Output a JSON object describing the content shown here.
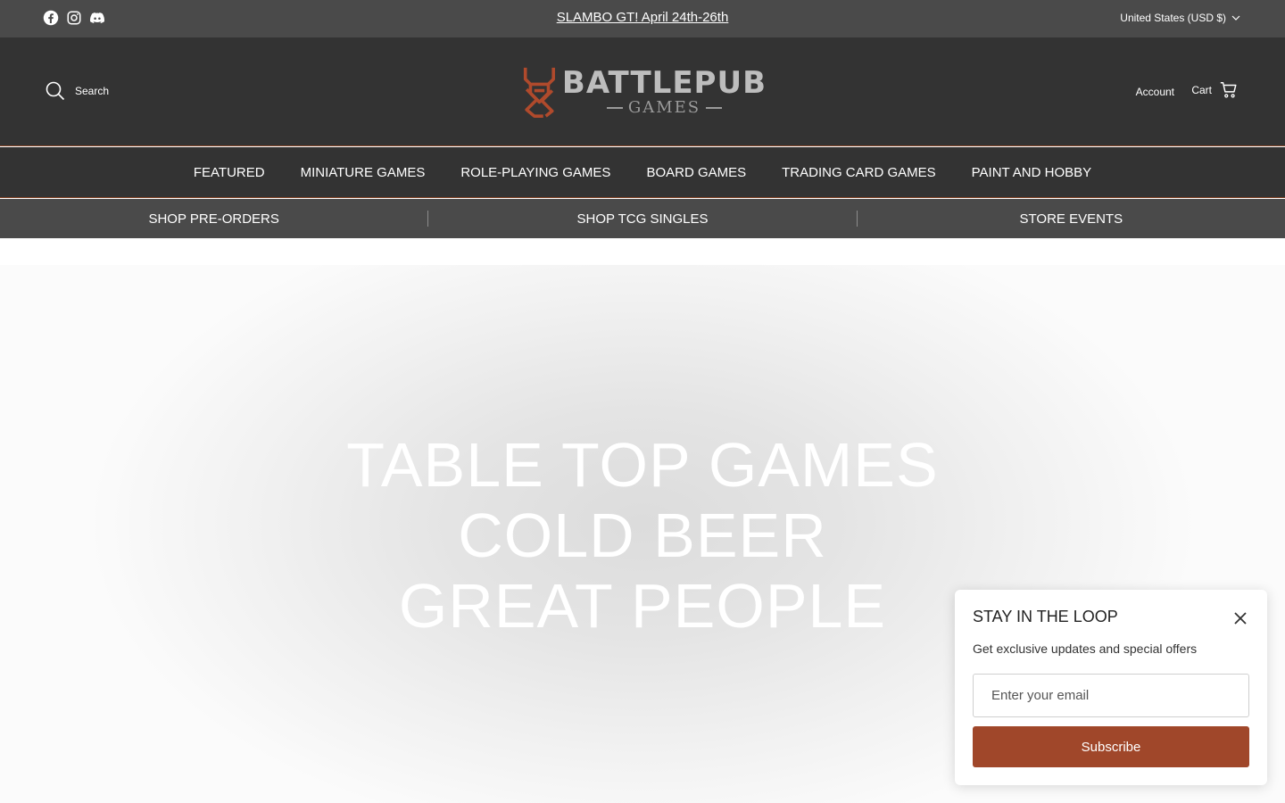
{
  "announcement": {
    "text": "SLAMBO GT! April 24th-26th",
    "socials": [
      "facebook-icon",
      "instagram-icon",
      "discord-icon"
    ],
    "currency": "United States (USD $)"
  },
  "header": {
    "search_label": "Search",
    "logo": {
      "word": "BATTLEPUB",
      "sub": "GAMES"
    },
    "account_label": "Account",
    "cart_label": "Cart"
  },
  "main_nav": [
    {
      "label": "FEATURED"
    },
    {
      "label": "MINIATURE GAMES"
    },
    {
      "label": "ROLE-PLAYING GAMES"
    },
    {
      "label": "BOARD GAMES"
    },
    {
      "label": "TRADING CARD GAMES"
    },
    {
      "label": "PAINT AND HOBBY"
    }
  ],
  "sub_nav": [
    {
      "label": "SHOP PRE-ORDERS"
    },
    {
      "label": "SHOP TCG SINGLES"
    },
    {
      "label": "STORE EVENTS"
    }
  ],
  "hero": {
    "lines": [
      "TABLE TOP GAMES",
      "COLD BEER",
      "GREAT PEOPLE"
    ]
  },
  "popup": {
    "title": "STAY IN THE LOOP",
    "description": "Get exclusive updates and special offers",
    "email_placeholder": "Enter your email",
    "button_label": "Subscribe"
  },
  "colors": {
    "topbar": "#4a4a4a",
    "header": "#333333",
    "accent": "#a0472a",
    "logo_mark": "#b04a2c"
  }
}
